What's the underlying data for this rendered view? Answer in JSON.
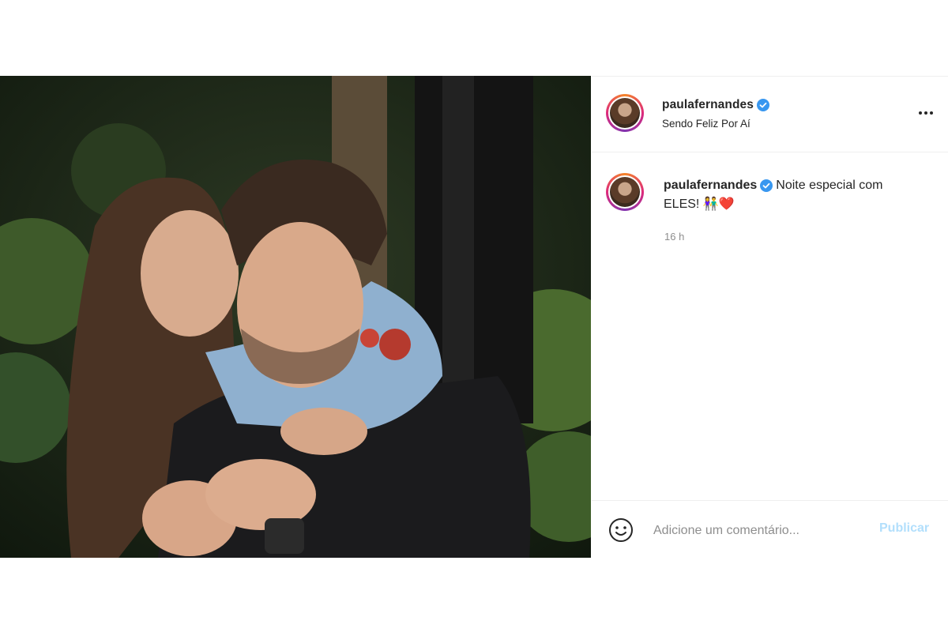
{
  "post": {
    "author": {
      "username": "paulafernandes",
      "verified": true,
      "location": "Sendo Feliz Por Aí"
    },
    "photo": {
      "icon": "photo-couple"
    },
    "caption": {
      "username": "paulafernandes",
      "text": "Noite especial com ELES! ",
      "emojis": "👫❤️"
    },
    "time_ago": "16 h"
  },
  "comment_bar": {
    "emoji_icon": "smiley-icon",
    "placeholder": "Adicione um comentário...",
    "publish_label": "Publicar"
  },
  "colors": {
    "link_disabled": "#b2dffc",
    "verified_blue": "#3897f0",
    "muted": "#8e8e8e"
  }
}
